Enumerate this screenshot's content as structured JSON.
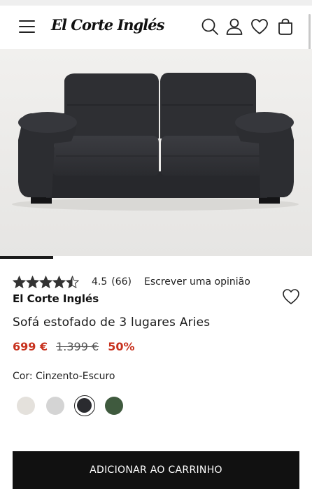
{
  "header": {
    "brand_logo": "El Corte Inglés",
    "icons": [
      "menu-icon",
      "search-icon",
      "user-icon",
      "heart-icon",
      "shopping-bag-icon"
    ]
  },
  "gallery": {
    "background": "#ebebeb",
    "sofa_color": "#2f3034",
    "progress_fraction": 0.17
  },
  "product": {
    "rating_value": "4.5",
    "stars_filled": 4.5,
    "rating_count": "(66)",
    "write_review": "Escrever uma opinião",
    "brand": "El Corte Inglés",
    "title": "Sofá estofado de 3 lugares Aries",
    "price_now": "699 €",
    "price_old": "1.399 €",
    "discount": "50%",
    "color_label": "Cor: Cinzento-Escuro",
    "swatches": [
      {
        "name": "bege",
        "color": "#e4e1dc",
        "selected": false
      },
      {
        "name": "cinzento-claro",
        "color": "#d4d4d4",
        "selected": false
      },
      {
        "name": "cinzento-escuro",
        "color": "#2a2b2f",
        "selected": true
      },
      {
        "name": "verde",
        "color": "#3f5a3e",
        "selected": false
      }
    ],
    "add_to_cart": "ADICIONAR AO CARRINHO"
  },
  "colors": {
    "accent_red": "#c8321e",
    "button_bg": "#111111"
  }
}
